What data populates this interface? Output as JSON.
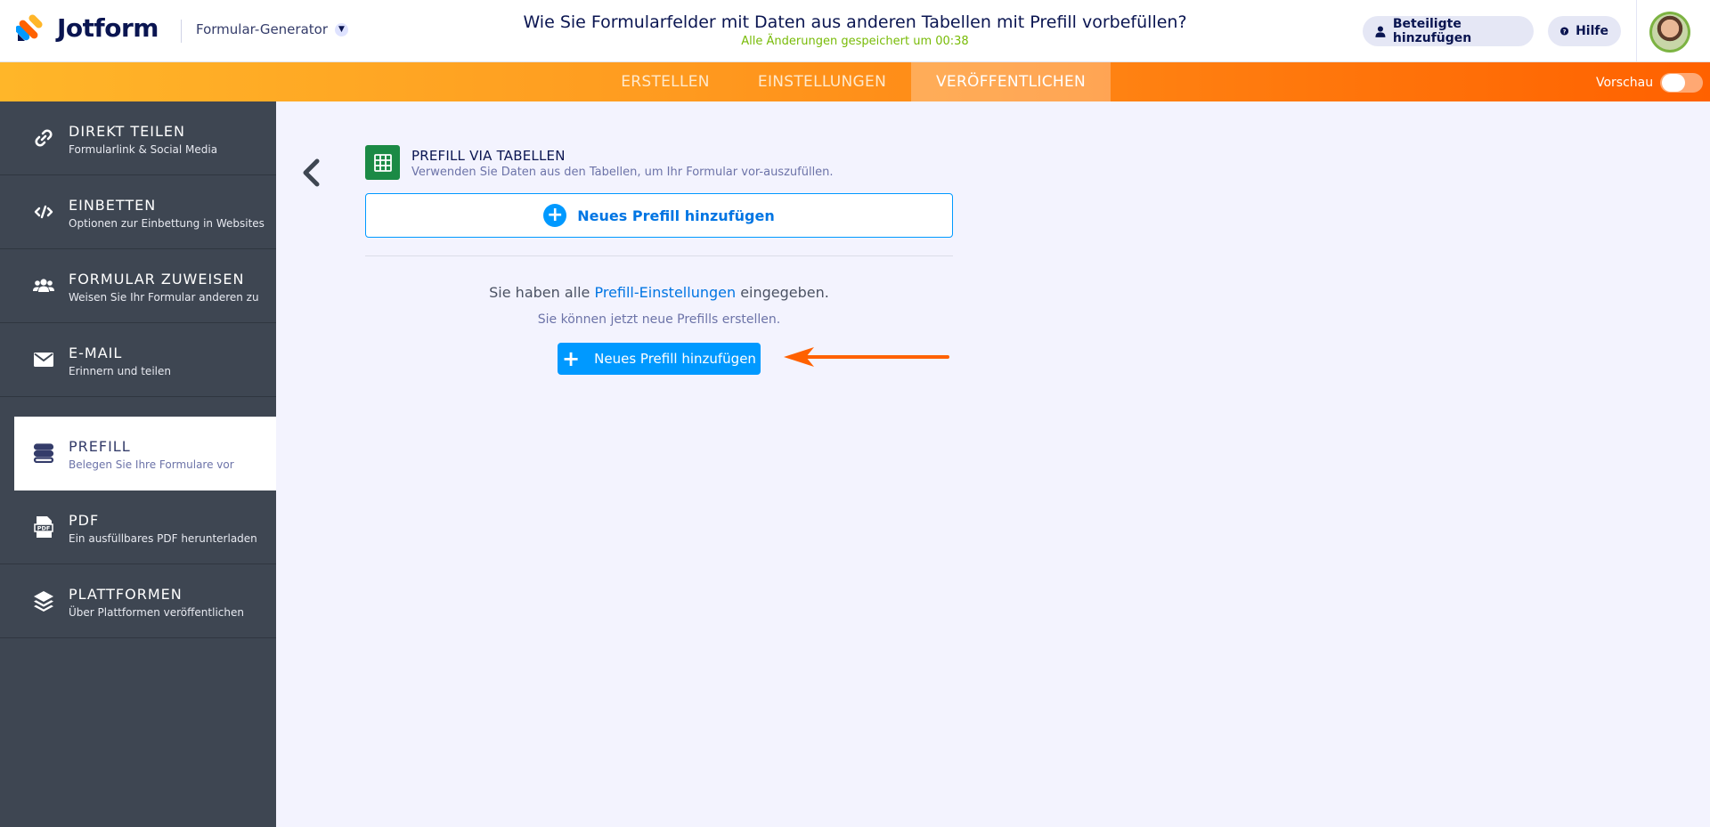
{
  "header": {
    "logo_text": "Jotform",
    "builder_label": "Formular-Generator",
    "form_title": "Wie Sie Formularfelder mit Daten aus anderen Tabellen mit Prefill vorbefüllen?",
    "saved_status": "Alle Änderungen gespeichert um 00:38",
    "invite_label": "Beteiligte hinzufügen",
    "help_label": "Hilfe"
  },
  "nav": {
    "tabs": [
      {
        "label": "ERSTELLEN"
      },
      {
        "label": "EINSTELLUNGEN"
      },
      {
        "label": "VERÖFFENTLICHEN"
      }
    ],
    "preview_label": "Vorschau"
  },
  "sidebar": {
    "items": [
      {
        "title": "DIREKT TEILEN",
        "subtitle": "Formularlink & Social Media",
        "icon": "link-icon"
      },
      {
        "title": "EINBETTEN",
        "subtitle": "Optionen zur Einbettung in Websites",
        "icon": "code-icon"
      },
      {
        "title": "FORMULAR ZUWEISEN",
        "subtitle": "Weisen Sie Ihr Formular anderen zu",
        "icon": "users-icon"
      },
      {
        "title": "E-MAIL",
        "subtitle": "Erinnern und teilen",
        "icon": "envelope-icon"
      },
      {
        "title": "PREFILL",
        "subtitle": "Belegen Sie Ihre Formulare vor",
        "icon": "prefill-icon"
      },
      {
        "title": "PDF",
        "subtitle": "Ein ausfüllbares PDF herunterladen",
        "icon": "pdf-icon"
      },
      {
        "title": "PLATTFORMEN",
        "subtitle": "Über Plattformen veröffentlichen",
        "icon": "layers-icon"
      }
    ],
    "active_index": 4
  },
  "main": {
    "section_title": "PREFILL VIA TABELLEN",
    "section_subtitle": "Verwenden Sie Daten aus den Tabellen, um Ihr Formular vor-auszufüllen.",
    "add_button_label": "Neues Prefill hinzufügen",
    "message_prefix": "Sie haben alle ",
    "message_link": "Prefill-Einstellungen",
    "message_suffix": " eingegeben.",
    "message_secondary": "Sie können jetzt neue Prefills erstellen.",
    "primary_button_label": "Neues Prefill hinzufügen"
  },
  "colors": {
    "accent_blue": "#0099ff",
    "orange": "#ff6100",
    "sidebar_bg": "#3e4652",
    "sheet_green": "#1b8a45",
    "saved_green": "#78bb07"
  }
}
